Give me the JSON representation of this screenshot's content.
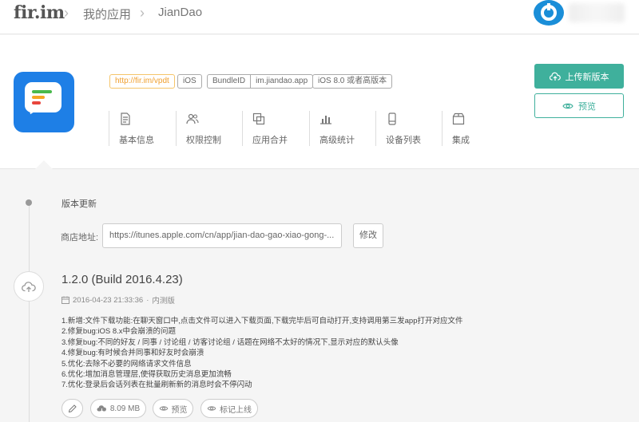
{
  "header": {
    "logo": "fir.im",
    "breadcrumb": [
      "我的应用",
      "JianDao"
    ],
    "separator": "›",
    "brand_color": "#1a8ed8"
  },
  "app": {
    "tags": {
      "short_link": "http://fir.im/vpdt",
      "platform": "iOS",
      "bundle_label": "BundleID",
      "bundle_id": "im.jiandao.app",
      "min_os": "iOS 8.0 或者高版本"
    },
    "nav": [
      {
        "label": "基本信息",
        "icon": "document-icon"
      },
      {
        "label": "权限控制",
        "icon": "users-icon"
      },
      {
        "label": "应用合并",
        "icon": "merge-icon"
      },
      {
        "label": "高级统计",
        "icon": "bar-chart-icon"
      },
      {
        "label": "设备列表",
        "icon": "device-icon"
      },
      {
        "label": "集成",
        "icon": "box-icon"
      }
    ],
    "actions": {
      "upload": "上传新版本",
      "preview": "预览"
    },
    "accent_color": "#3fb09c"
  },
  "content": {
    "section_title": "版本更新",
    "store_label": "商店地址:",
    "store_value": "https://itunes.apple.com/cn/app/jian-dao-gao-xiao-gong-...",
    "edit_label": "修改",
    "release": {
      "version": "1.2.0 (Build 2016.4.23)",
      "date": "2016-04-23 21:33:36",
      "dot": "·",
      "channel": "内测版",
      "notes": [
        "1.新增:文件下载功能:在聊天窗口中,点击文件可以进入下载页面,下载完毕后可自动打开,支持调用第三发app打开对应文件",
        "2.修复bug:iOS 8.x中会崩溃的问题",
        "3.修复bug:不同的好友 / 同事 / 讨论组 / 访客讨论组 / 话题在网络不太好的情况下,显示对应的默认头像",
        "4.修复bug:有时候合并同事和好友时会崩溃",
        "5.优化:去除不必要的网络请求文件信息",
        "6.优化:增加消息管理层,使得获取历史消息更加流畅",
        "7.优化:登录后会话列表在批量刷新新的消息时会不停闪动"
      ],
      "size": "8.09 MB",
      "preview": "预览",
      "mark_online": "标记上线"
    }
  }
}
